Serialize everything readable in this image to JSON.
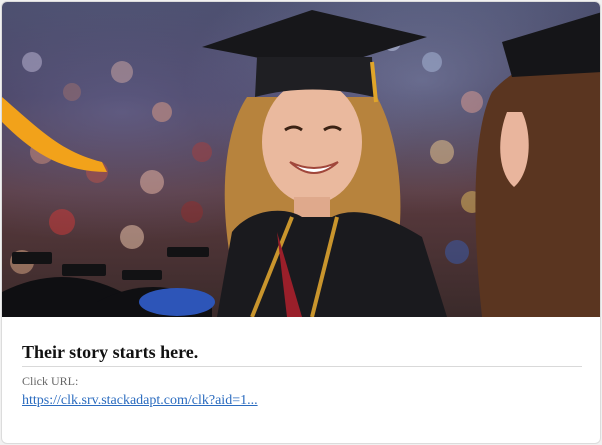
{
  "ad": {
    "image_alt": "Smiling graduate in cap and gown at commencement ceremony",
    "headline": "Their story starts here.",
    "click_url_label": "Click URL:",
    "click_url": "https://clk.srv.stackadapt.com/clk?aid=1..."
  },
  "colors": {
    "link": "#2a6bbf",
    "headline": "#111111",
    "label": "#666666",
    "tassel": "#f2a21a",
    "gown": "#1a1a1e"
  }
}
